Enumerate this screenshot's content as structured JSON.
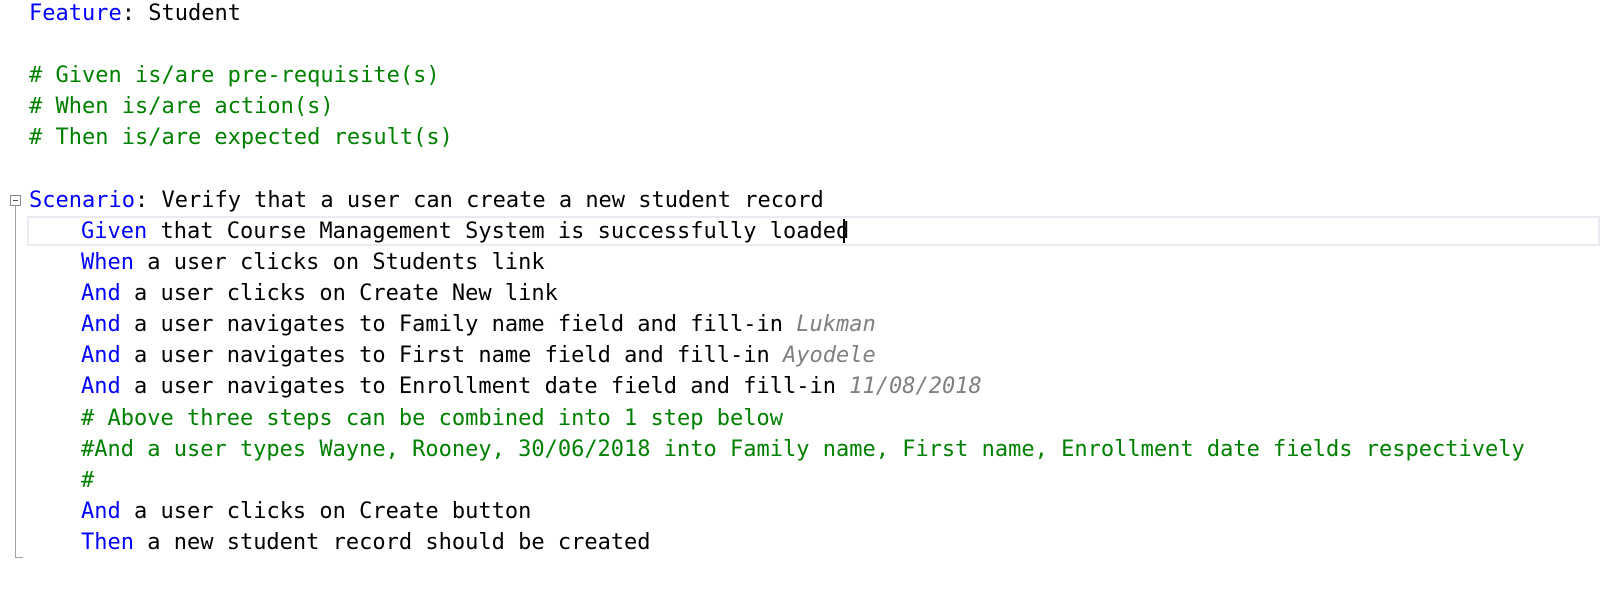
{
  "editor": {
    "feature": {
      "keyword": "Feature",
      "sep": ": ",
      "name": "Student"
    },
    "header_comments": [
      "# Given is/are pre-requisite(s)",
      "# When is/are action(s)",
      "# Then is/are expected result(s)"
    ],
    "scenario": {
      "keyword": "Scenario",
      "sep": ": ",
      "title": "Verify that a user can create a new student record"
    },
    "steps": [
      {
        "keyword": "Given",
        "text": " that Course Management System is successfully loaded"
      },
      {
        "keyword": "When",
        "text": " a user clicks on Students link"
      },
      {
        "keyword": "And",
        "text": " a user clicks on Create New link"
      },
      {
        "keyword": "And",
        "text": " a user navigates to Family name field and fill-in ",
        "param": "Lukman"
      },
      {
        "keyword": "And",
        "text": " a user navigates to First name field and fill-in ",
        "param": "Ayodele"
      },
      {
        "keyword": "And",
        "text": " a user navigates to Enrollment date field and fill-in ",
        "param": "11/08/2018"
      },
      {
        "comment": "# Above three steps can be combined into 1 step below"
      },
      {
        "comment": "#And a user types Wayne, Rooney, 30/06/2018 into Family name, First name, Enrollment date fields respectively"
      },
      {
        "comment": "#"
      },
      {
        "keyword": "And",
        "text": " a user clicks on Create button"
      },
      {
        "keyword": "Then",
        "text": " a new student record should be created"
      }
    ],
    "colors": {
      "keyword": "#0000ff",
      "comment": "#008000",
      "parameter": "#808080",
      "text": "#000000"
    }
  }
}
